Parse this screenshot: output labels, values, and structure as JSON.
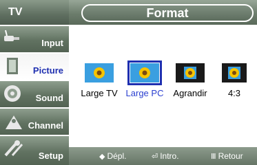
{
  "sidebar": {
    "title": "TV",
    "items": [
      {
        "label": "Input",
        "icon": "input-cable-icon",
        "active": false
      },
      {
        "label": "Picture",
        "icon": "picture-screen-icon",
        "active": true
      },
      {
        "label": "Sound",
        "icon": "speaker-icon",
        "active": false
      },
      {
        "label": "Channel",
        "icon": "satellite-dish-icon",
        "active": false
      },
      {
        "label": "Setup",
        "icon": "tools-icon",
        "active": false
      }
    ]
  },
  "header": {
    "title": "Format"
  },
  "options": [
    {
      "label": "Large TV",
      "selected": false
    },
    {
      "label": "Large PC",
      "selected": true
    },
    {
      "label": "Agrandir",
      "selected": false
    },
    {
      "label": "4:3",
      "selected": false
    }
  ],
  "footer": {
    "move_symbol": "◆",
    "move_label": "Dépl.",
    "enter_symbol": "⏎",
    "enter_label": "Intro.",
    "return_symbol": "Ⅲ",
    "return_label": "Retour"
  },
  "colors": {
    "active_text": "#1e2fb0",
    "selected_text": "#2a3fd0",
    "bar": "#667566"
  }
}
